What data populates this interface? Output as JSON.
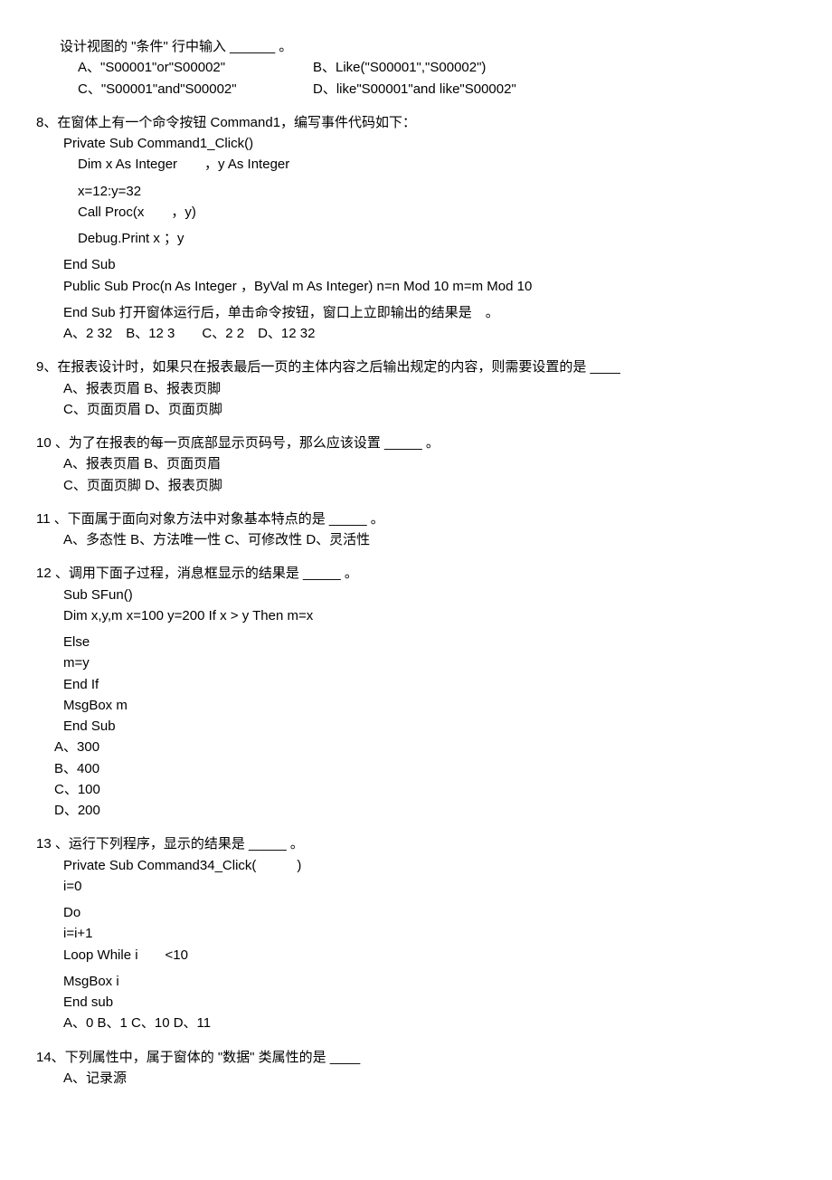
{
  "q7": {
    "stem": "设计视图的 \"条件\" 行中输入 ______ 。",
    "A": "A、\"S00001\"or\"S00002\"",
    "B": "B、Like(\"S00001\",\"S00002\")",
    "C": "C、\"S00001\"and\"S00002\"",
    "D": "D、like\"S00001\"and like\"S00002\""
  },
  "q8": {
    "num": "8、",
    "stem": "在窗体上有一个命令按钮 Command1，编写事件代码如下：",
    "c1": "Private Sub Command1_Click()",
    "c2": "Dim x As Integer  ，y As Integer",
    "c3": "x=12:y=32",
    "c4": "Call Proc(x  ，y)",
    "c5": "Debug.Print x ；y",
    "c6": "End Sub",
    "c7": "Public Sub Proc(n As Integer ，ByVal m As Integer) n=n Mod 10 m=m Mod 10",
    "c8": "End Sub 打开窗体运行后，单击命令按钮，窗口上立即输出的结果是 。",
    "opts": "A、2 32 B、12 3  C、2 2 D、12 32"
  },
  "q9": {
    "num": "9、",
    "stem": "在报表设计时，如果只在报表最后一页的主体内容之后输出规定的内容，则需要设置的是 ____",
    "r1": "A、报表页眉 B、报表页脚",
    "r2": "C、页面页眉 D、页面页脚"
  },
  "q10": {
    "num": "10 、",
    "stem": "为了在报表的每一页底部显示页码号，那么应该设置 _____ 。",
    "r1": "A、报表页眉 B、页面页眉",
    "r2": "C、页面页脚 D、报表页脚"
  },
  "q11": {
    "num": "11 、",
    "stem": "下面属于面向对象方法中对象基本特点的是 _____ 。",
    "r1": "A、多态性 B、方法唯一性 C、可修改性 D、灵活性"
  },
  "q12": {
    "num": "12 、",
    "stem": "调用下面子过程，消息框显示的结果是 _____ 。",
    "c1": "Sub SFun()",
    "c2": "Dim x,y,m x=100 y=200 If x > y Then m=x",
    "c3": "Else",
    "c4": "m=y",
    "c5": "End If",
    "c6": "MsgBox m",
    "c7": "End Sub",
    "oA": "A、300",
    "oB": "B、400",
    "oC": "C、100",
    "oD": "D、200"
  },
  "q13": {
    "num": "13 、",
    "stem": "运行下列程序，显示的结果是 _____ 。",
    "c1": "Private Sub Command34_Click(   )",
    "c2": "i=0",
    "c3": "Do",
    "c4": "i=i+1",
    "c5": "Loop While i  <10",
    "c6": "MsgBox i",
    "c7": "End sub",
    "opts": "A、0 B、1 C、10 D、11"
  },
  "q14": {
    "num": "14、",
    "stem": "下列属性中，属于窗体的 \"数据\" 类属性的是 ____",
    "r1": "A、记录源"
  }
}
